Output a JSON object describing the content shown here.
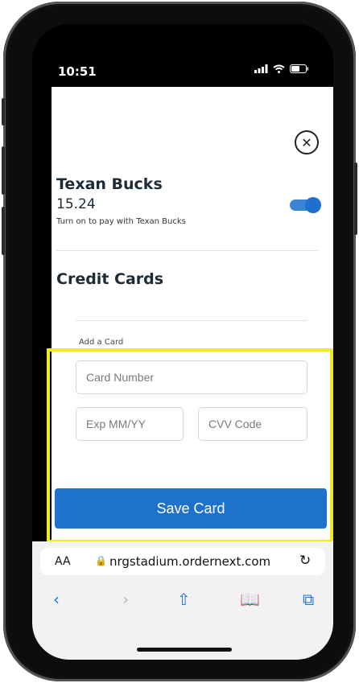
{
  "status": {
    "time": "10:51"
  },
  "close_label": "✕",
  "texan_bucks": {
    "title": "Texan Bucks",
    "balance": "15.24",
    "hint": "Turn on to pay with Texan Bucks",
    "enabled": true
  },
  "credit_cards": {
    "title": "Credit Cards",
    "add_label": "Add a Card",
    "card_number_placeholder": "Card Number",
    "exp_placeholder": "Exp MM/YY",
    "cvv_placeholder": "CVV Code",
    "save_label": "Save Card"
  },
  "browser": {
    "aa_label": "AA",
    "lock_icon": "🔒",
    "url": "nrgstadium.ordernext.com",
    "reload_icon": "↻",
    "toolbar": {
      "back": "‹",
      "forward": "›",
      "share": "⇧",
      "bookmarks": "📖",
      "tabs": "⧉"
    }
  },
  "colors": {
    "accent": "#1f72cc",
    "highlight": "#f3ea1c",
    "toggle": "#1e6fd0"
  }
}
